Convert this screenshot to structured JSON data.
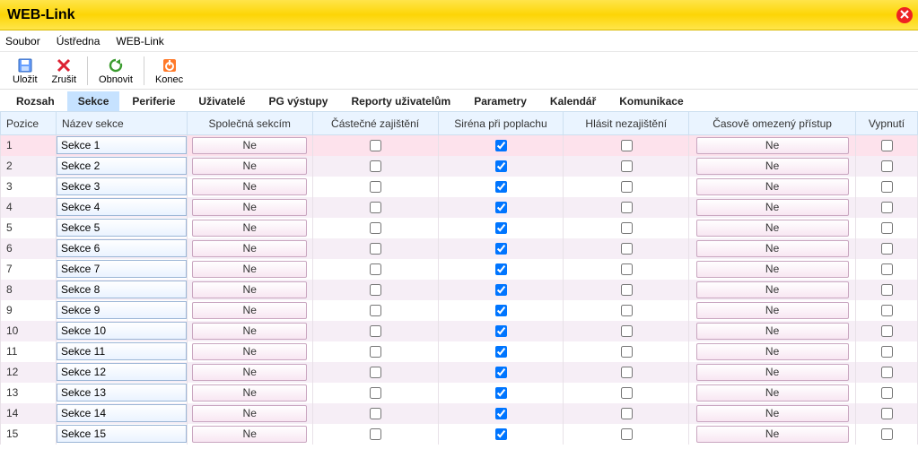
{
  "window": {
    "title": "WEB-Link"
  },
  "menu": {
    "items": [
      "Soubor",
      "Ústředna",
      "WEB-Link"
    ]
  },
  "toolbar": {
    "save": {
      "label": "Uložit"
    },
    "cancel": {
      "label": "Zrušit"
    },
    "refresh": {
      "label": "Obnovit"
    },
    "end": {
      "label": "Konec"
    }
  },
  "tabs": {
    "items": [
      "Rozsah",
      "Sekce",
      "Periferie",
      "Uživatelé",
      "PG výstupy",
      "Reporty uživatelům",
      "Parametry",
      "Kalendář",
      "Komunikace"
    ],
    "active_index": 1
  },
  "columns": {
    "pozice": "Pozice",
    "nazev": "Název sekce",
    "spolecna": "Společná sekcím",
    "castecne": "Částečné zajištění",
    "sirena": "Siréna při poplachu",
    "hlasit": "Hlásit nezajištění",
    "casove": "Časově omezený přístup",
    "vypnuti": "Vypnutí"
  },
  "common_value": "Ne",
  "selected_row": 0,
  "rows": [
    {
      "pos": "1",
      "name": "Sekce 1",
      "spolecna": "Ne",
      "castecne": false,
      "sirena": true,
      "hlasit": false,
      "casove": "Ne",
      "vypnuti": false
    },
    {
      "pos": "2",
      "name": "Sekce 2",
      "spolecna": "Ne",
      "castecne": false,
      "sirena": true,
      "hlasit": false,
      "casove": "Ne",
      "vypnuti": false
    },
    {
      "pos": "3",
      "name": "Sekce 3",
      "spolecna": "Ne",
      "castecne": false,
      "sirena": true,
      "hlasit": false,
      "casove": "Ne",
      "vypnuti": false
    },
    {
      "pos": "4",
      "name": "Sekce 4",
      "spolecna": "Ne",
      "castecne": false,
      "sirena": true,
      "hlasit": false,
      "casove": "Ne",
      "vypnuti": false
    },
    {
      "pos": "5",
      "name": "Sekce 5",
      "spolecna": "Ne",
      "castecne": false,
      "sirena": true,
      "hlasit": false,
      "casove": "Ne",
      "vypnuti": false
    },
    {
      "pos": "6",
      "name": "Sekce 6",
      "spolecna": "Ne",
      "castecne": false,
      "sirena": true,
      "hlasit": false,
      "casove": "Ne",
      "vypnuti": false
    },
    {
      "pos": "7",
      "name": "Sekce 7",
      "spolecna": "Ne",
      "castecne": false,
      "sirena": true,
      "hlasit": false,
      "casove": "Ne",
      "vypnuti": false
    },
    {
      "pos": "8",
      "name": "Sekce 8",
      "spolecna": "Ne",
      "castecne": false,
      "sirena": true,
      "hlasit": false,
      "casove": "Ne",
      "vypnuti": false
    },
    {
      "pos": "9",
      "name": "Sekce 9",
      "spolecna": "Ne",
      "castecne": false,
      "sirena": true,
      "hlasit": false,
      "casove": "Ne",
      "vypnuti": false
    },
    {
      "pos": "10",
      "name": "Sekce 10",
      "spolecna": "Ne",
      "castecne": false,
      "sirena": true,
      "hlasit": false,
      "casove": "Ne",
      "vypnuti": false
    },
    {
      "pos": "11",
      "name": "Sekce 11",
      "spolecna": "Ne",
      "castecne": false,
      "sirena": true,
      "hlasit": false,
      "casove": "Ne",
      "vypnuti": false
    },
    {
      "pos": "12",
      "name": "Sekce 12",
      "spolecna": "Ne",
      "castecne": false,
      "sirena": true,
      "hlasit": false,
      "casove": "Ne",
      "vypnuti": false
    },
    {
      "pos": "13",
      "name": "Sekce 13",
      "spolecna": "Ne",
      "castecne": false,
      "sirena": true,
      "hlasit": false,
      "casove": "Ne",
      "vypnuti": false
    },
    {
      "pos": "14",
      "name": "Sekce 14",
      "spolecna": "Ne",
      "castecne": false,
      "sirena": true,
      "hlasit": false,
      "casove": "Ne",
      "vypnuti": false
    },
    {
      "pos": "15",
      "name": "Sekce 15",
      "spolecna": "Ne",
      "castecne": false,
      "sirena": true,
      "hlasit": false,
      "casove": "Ne",
      "vypnuti": false
    }
  ]
}
